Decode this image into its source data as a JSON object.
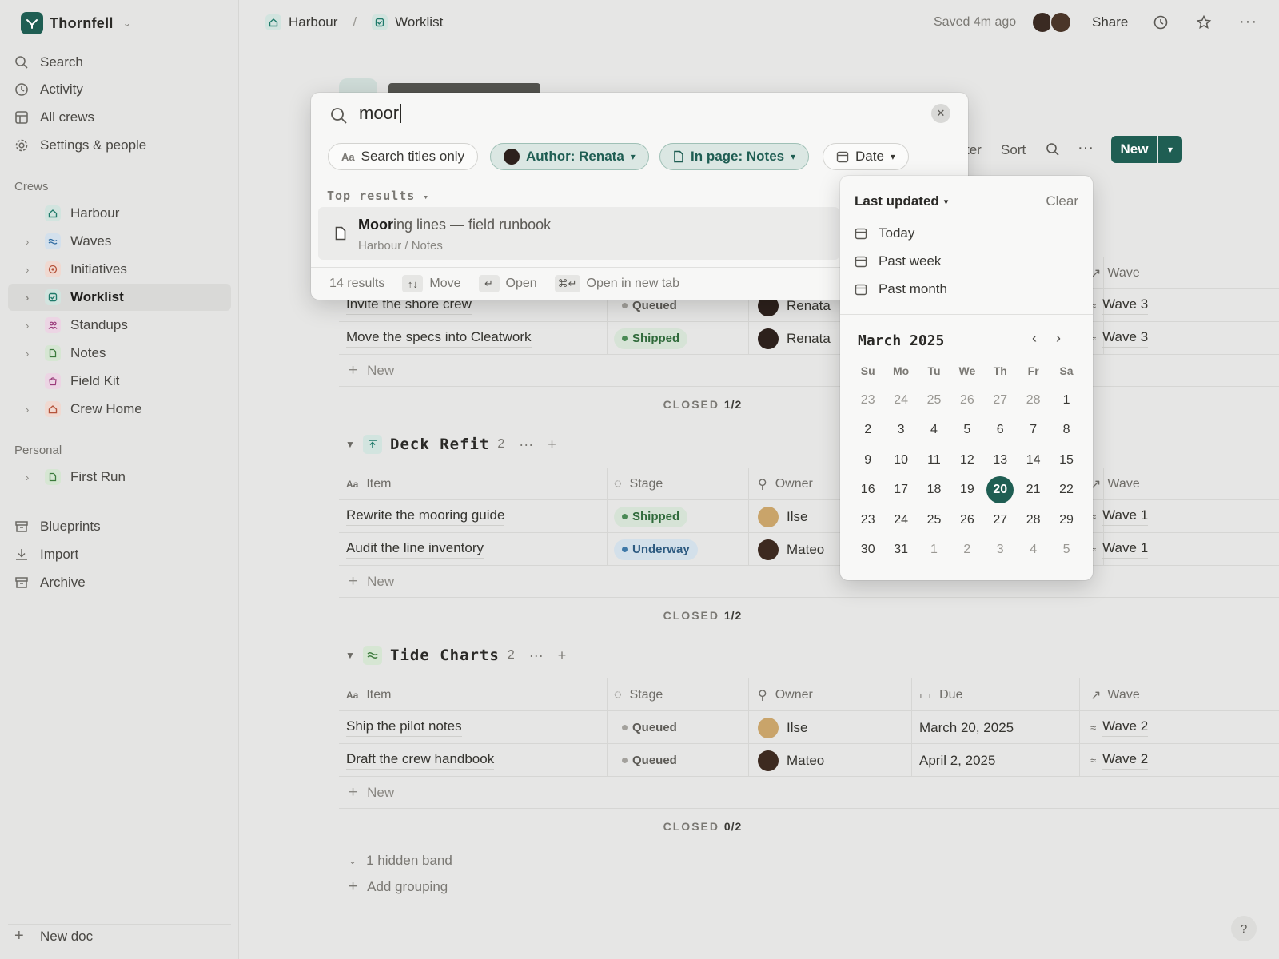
{
  "workspace": {
    "name": "Thornfell"
  },
  "sidebar": {
    "nav": [
      {
        "label": "Search",
        "icon": "search-icon"
      },
      {
        "label": "Activity",
        "icon": "clock-icon"
      },
      {
        "label": "All crews",
        "icon": "table-icon"
      },
      {
        "label": "Settings & people",
        "icon": "gear-icon"
      }
    ],
    "crews_heading": "Crews",
    "crews": [
      {
        "label": "Harbour",
        "icon": "home-icon",
        "color": "#1f7a6a",
        "bg": "#d2e4df"
      },
      {
        "label": "Waves",
        "icon": "waves-icon",
        "color": "#2d6aa0",
        "bg": "#d3e0ec"
      },
      {
        "label": "Initiatives",
        "icon": "target-icon",
        "color": "#b5533a",
        "bg": "#f0d9d1"
      },
      {
        "label": "Worklist",
        "icon": "checkbox-icon",
        "color": "#1f7a6a",
        "bg": "#d2e4df"
      },
      {
        "label": "Standups",
        "icon": "people-icon",
        "color": "#9a3a7a",
        "bg": "#ecd5e4"
      },
      {
        "label": "Notes",
        "icon": "doc-icon",
        "color": "#3b7a3b",
        "bg": "#d6e6d3"
      },
      {
        "label": "Field Kit",
        "icon": "bag-icon",
        "color": "#9a3a7a",
        "bg": "#ecd5e4"
      },
      {
        "label": "Crew Home",
        "icon": "home-icon",
        "color": "#b5533a",
        "bg": "#f0d9d1"
      }
    ],
    "personal_heading": "Personal",
    "personal": [
      {
        "label": "First Run",
        "icon": "doc-icon"
      }
    ],
    "bottom": [
      {
        "label": "Blueprints",
        "icon": "archive-icon"
      },
      {
        "label": "Import",
        "icon": "download-icon"
      },
      {
        "label": "Archive",
        "icon": "archive-icon"
      }
    ],
    "new_doc": "New doc"
  },
  "topbar": {
    "crumbs": [
      "Harbour",
      "Worklist"
    ],
    "separator": "/",
    "saved": "Saved 4m ago",
    "share": "Share"
  },
  "toolbar": {
    "filter_partial": "ter",
    "sort": "Sort",
    "new": "New"
  },
  "search": {
    "query": "moor",
    "chips": {
      "titles": "Search titles only",
      "author": "Author: Renata",
      "inpage": "In page: Notes",
      "date": "Date"
    },
    "top_results": "Top results",
    "result": {
      "match": "Moor",
      "rest": "ing lines — field runbook",
      "path": "Harbour / Notes"
    },
    "count": "14 results",
    "footer": {
      "move_key": "↑↓",
      "move": "Move",
      "open_key": "↵",
      "open": "Open",
      "newtab_key": "⌘↵",
      "newtab": "Open in new tab"
    }
  },
  "datepop": {
    "sort": "Last updated",
    "clear": "Clear",
    "options": [
      "Today",
      "Past week",
      "Past month"
    ],
    "month": "March 2025",
    "dow": [
      "Su",
      "Mo",
      "Tu",
      "We",
      "Th",
      "Fr",
      "Sa"
    ],
    "weeks": [
      [
        "23",
        "24",
        "25",
        "26",
        "27",
        "28",
        "1"
      ],
      [
        "2",
        "3",
        "4",
        "5",
        "6",
        "7",
        "8"
      ],
      [
        "9",
        "10",
        "11",
        "12",
        "13",
        "14",
        "15"
      ],
      [
        "16",
        "17",
        "18",
        "19",
        "20",
        "21",
        "22"
      ],
      [
        "23",
        "24",
        "25",
        "26",
        "27",
        "28",
        "29"
      ],
      [
        "30",
        "31",
        "1",
        "2",
        "3",
        "4",
        "5"
      ]
    ],
    "selected": "20"
  },
  "table": {
    "headers": {
      "item": "Item",
      "stage": "Stage",
      "owner": "Owner",
      "due": "Due",
      "wave": "Wave"
    },
    "new_row": "New",
    "closed_label": "CLOSED",
    "group1": {
      "rows": [
        {
          "item": "Invite the shore crew",
          "stage": "Queued",
          "owner": "Renata",
          "wave": "Wave 3"
        },
        {
          "item": "Move the specs into Cleatwork",
          "stage": "Shipped",
          "owner": "Renata",
          "wave": "Wave 3"
        }
      ],
      "closed": "1/2"
    },
    "group2": {
      "title": "Deck Refit",
      "count": "2",
      "rows": [
        {
          "item": "Rewrite the mooring guide",
          "stage": "Shipped",
          "owner": "Ilse",
          "wave": "Wave 1"
        },
        {
          "item": "Audit the line inventory",
          "stage": "Underway",
          "owner": "Mateo",
          "wave": "Wave 1"
        }
      ],
      "closed": "1/2"
    },
    "group3": {
      "title": "Tide Charts",
      "count": "2",
      "rows": [
        {
          "item": "Ship the pilot notes",
          "stage": "Queued",
          "owner": "Ilse",
          "due": "March 20, 2025",
          "wave": "Wave 2"
        },
        {
          "item": "Draft the crew handbook",
          "stage": "Queued",
          "owner": "Mateo",
          "due": "April 2, 2025",
          "wave": "Wave 2"
        }
      ],
      "closed": "0/2"
    },
    "hidden_band": "1 hidden band",
    "add_grouping": "Add grouping"
  },
  "help": "?"
}
